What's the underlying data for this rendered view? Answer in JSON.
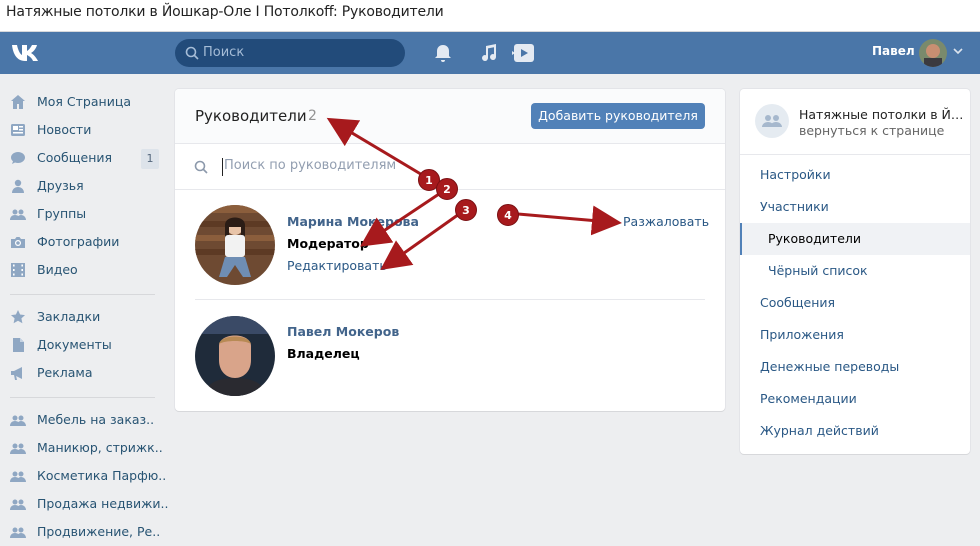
{
  "window": {
    "title": "Натяжные потолки в Йошкар-Оле I Потолкoff: Руководители"
  },
  "header": {
    "search_placeholder": "Поиск",
    "user_name": "Павел"
  },
  "left_nav": {
    "items": [
      {
        "label": "Моя Страница",
        "icon": "home-icon"
      },
      {
        "label": "Новости",
        "icon": "news-icon"
      },
      {
        "label": "Сообщения",
        "icon": "messages-icon",
        "badge": "1"
      },
      {
        "label": "Друзья",
        "icon": "friends-icon"
      },
      {
        "label": "Группы",
        "icon": "groups-icon"
      },
      {
        "label": "Фотографии",
        "icon": "camera-icon"
      },
      {
        "label": "Видео",
        "icon": "video-icon"
      },
      {
        "label": "Закладки",
        "icon": "star-icon"
      },
      {
        "label": "Документы",
        "icon": "document-icon"
      },
      {
        "label": "Реклама",
        "icon": "megaphone-icon"
      },
      {
        "label": "Мебель на заказ..",
        "icon": "group-icon"
      },
      {
        "label": "Маникюр, стрижк..",
        "icon": "group-icon"
      },
      {
        "label": "Косметика Парфю..",
        "icon": "group-icon"
      },
      {
        "label": "Продажа недвижи..",
        "icon": "group-icon"
      },
      {
        "label": "Продвижение, Ре..",
        "icon": "group-icon"
      }
    ]
  },
  "main": {
    "title": "Руководители",
    "count": "2",
    "add_button": "Добавить руководителя",
    "search_placeholder": "Поиск по руководителям",
    "members": [
      {
        "name": "Марина Мокерова",
        "role": "Модератор",
        "edit": "Редактировать",
        "demote": "Разжаловать"
      },
      {
        "name": "Павел Мокеров",
        "role": "Владелец"
      }
    ]
  },
  "right": {
    "group_name": "Натяжные потолки в Йошкар-Оле",
    "back": "вернуться к странице",
    "menu": [
      {
        "label": "Настройки"
      },
      {
        "label": "Участники"
      },
      {
        "label": "Руководители",
        "active": true
      },
      {
        "label": "Чёрный список"
      },
      {
        "label": "Сообщения"
      },
      {
        "label": "Приложения"
      },
      {
        "label": "Денежные переводы"
      },
      {
        "label": "Рекомендации"
      },
      {
        "label": "Журнал действий"
      }
    ]
  },
  "annotations": {
    "markers": [
      "1",
      "2",
      "3",
      "4"
    ]
  },
  "colors": {
    "header": "#4a76a8",
    "button": "#5181b8",
    "link": "#2a5885",
    "arrow": "#a71a1d"
  }
}
